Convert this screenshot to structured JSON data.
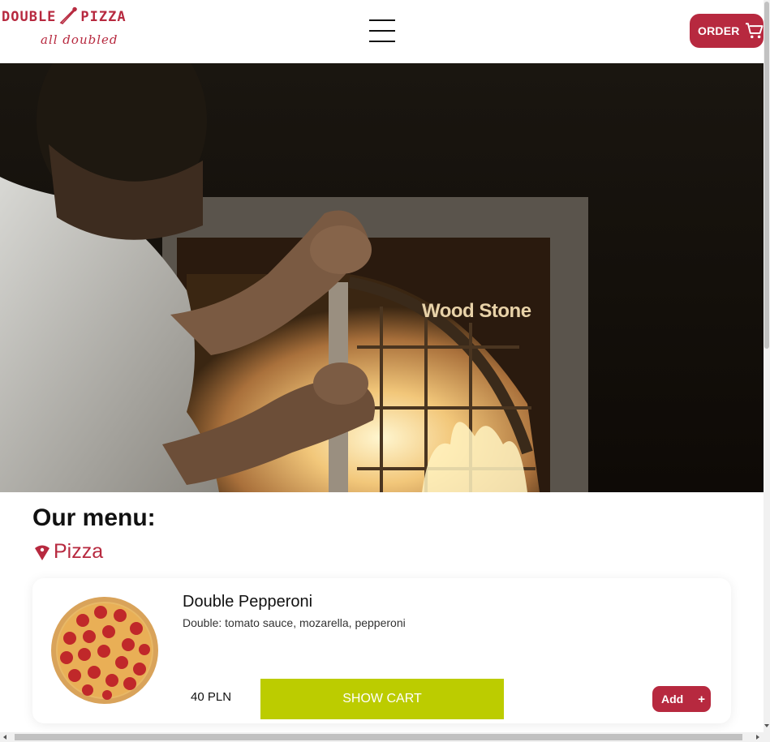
{
  "brand": {
    "name_left": "DOUBLE",
    "name_right": "PIZZA",
    "tagline": "all doubled",
    "color": "#b7293f"
  },
  "header": {
    "menu_icon": "hamburger-menu-icon",
    "order_label": "ORDER",
    "cart_icon": "shopping-cart-icon"
  },
  "hero": {
    "oven_brand_text": "Wood Stone"
  },
  "menu": {
    "title": "Our menu:",
    "category": {
      "icon": "pizza-slice-icon",
      "label": "Pizza"
    },
    "items": [
      {
        "name": "Double Pepperoni",
        "description": "Double: tomato sauce, mozarella, pepperoni",
        "price": "40 PLN",
        "show_cart_label": "SHOW CART",
        "add_label": "Add",
        "add_icon": "+"
      }
    ]
  },
  "colors": {
    "accent": "#b7293f",
    "show_cart": "#bccc00"
  }
}
